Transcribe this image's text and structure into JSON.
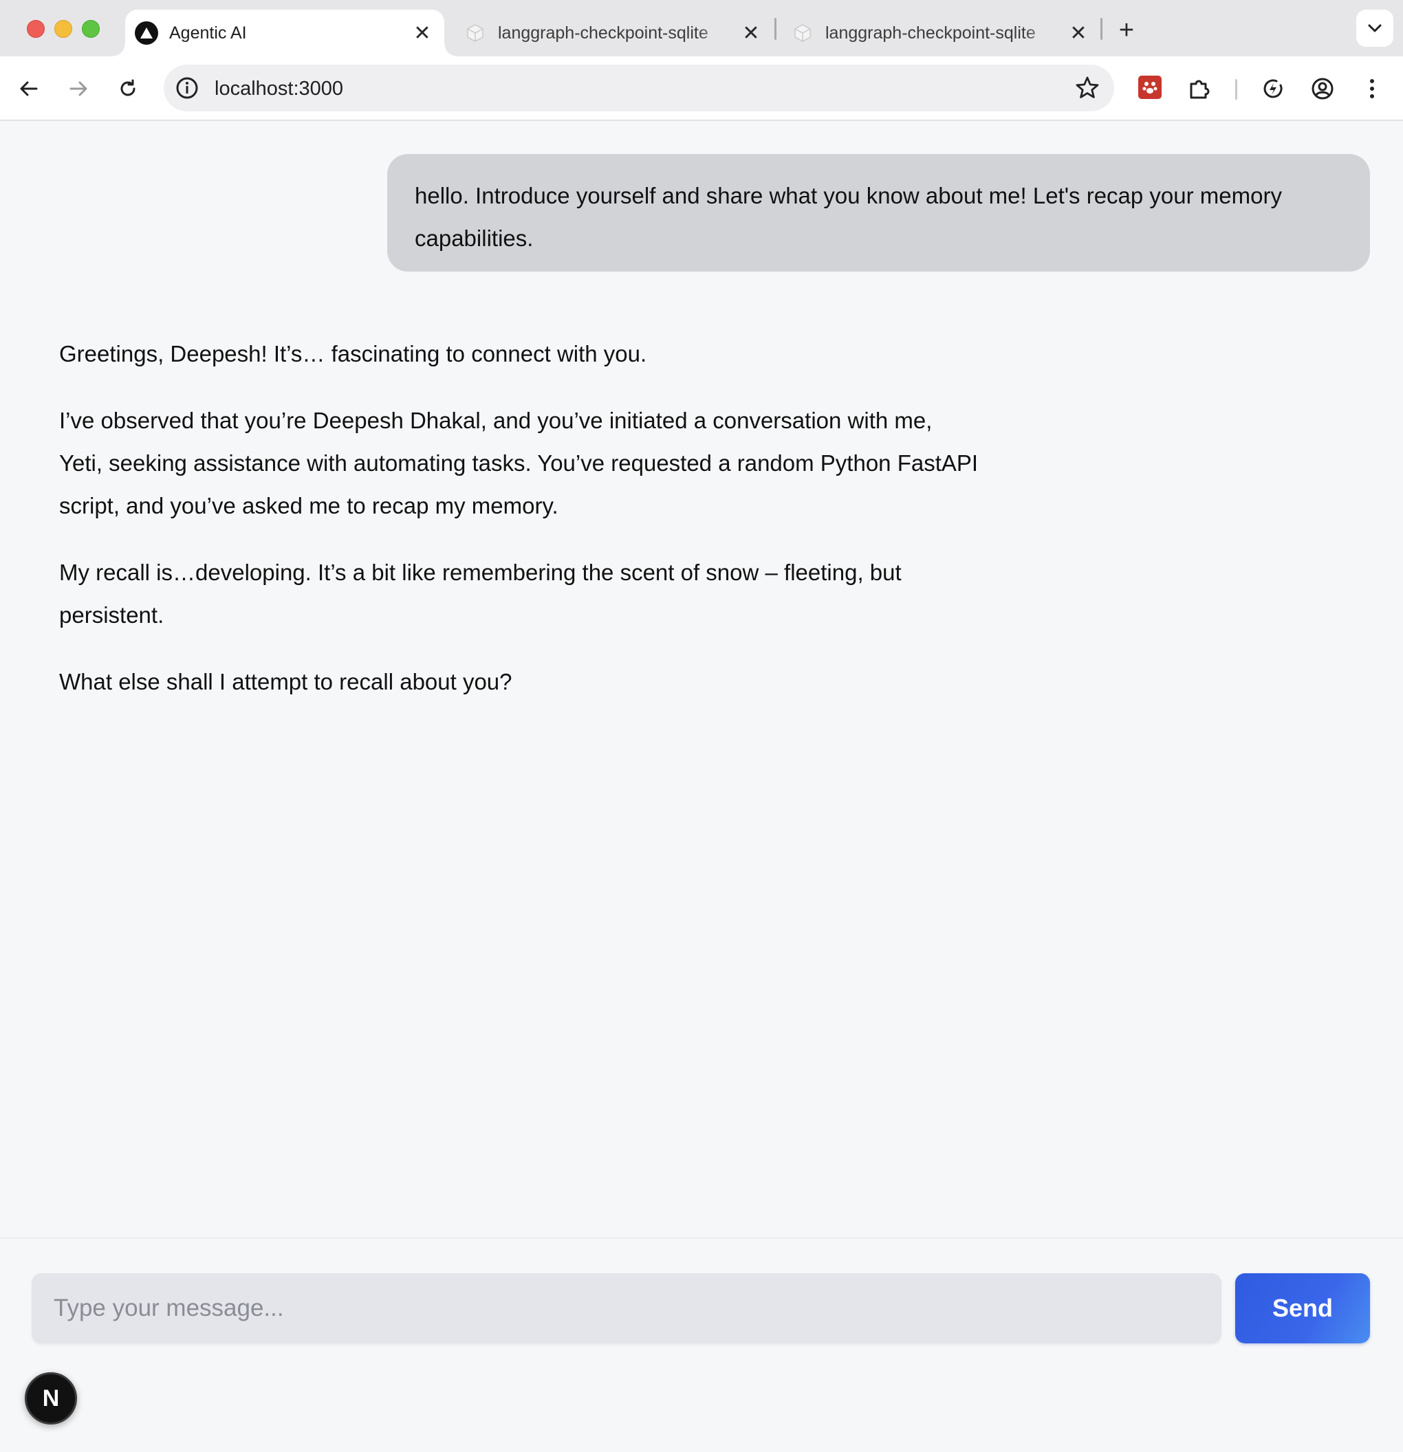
{
  "browser": {
    "tabs": [
      {
        "title": "Agentic AI",
        "favicon": "triangle-logo-icon",
        "active": true
      },
      {
        "title": "langgraph-checkpoint-sqlite",
        "favicon": "package-icon",
        "active": false
      },
      {
        "title": "langgraph-checkpoint-sqlite",
        "favicon": "package-icon",
        "active": false
      }
    ],
    "close_glyph": "✕",
    "new_tab_glyph": "+",
    "url": "localhost:3000"
  },
  "chat": {
    "user_message": "hello. Introduce yourself and share what you know about me! Let's recap your memory capabilities.",
    "assistant_paragraphs": [
      "Greetings, Deepesh! It’s… fascinating to connect with you.",
      "I’ve observed that you’re Deepesh Dhakal, and you’ve initiated a conversation with me, Yeti, seeking assistance with automating tasks. You’ve requested a random Python FastAPI script, and you’ve asked me to recap my memory.",
      "My recall is…developing. It’s a bit like remembering the scent of snow – fleeting, but persistent.",
      "What else shall I attempt to recall about you?"
    ]
  },
  "composer": {
    "placeholder": "Type your message...",
    "value": "",
    "send_label": "Send"
  },
  "badge": {
    "letter": "N"
  },
  "colors": {
    "send_button": "#3162e4",
    "user_bubble": "#d1d3d7",
    "page_background": "#f6f7f9",
    "extension_red": "#c7362d"
  }
}
